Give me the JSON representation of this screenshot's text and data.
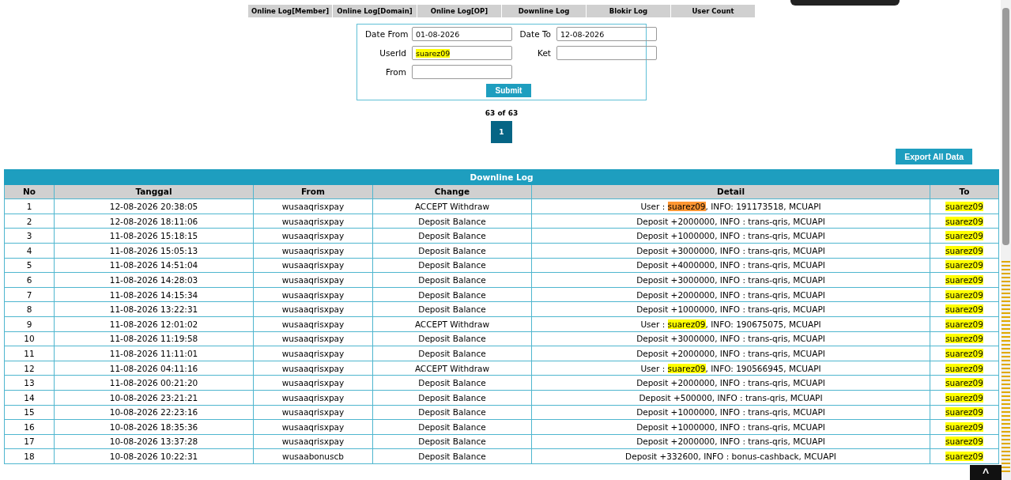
{
  "tabs": [
    {
      "label": "Online Log[Member]",
      "selected": false
    },
    {
      "label": "Online Log[Domain]",
      "selected": false
    },
    {
      "label": "Online Log[OP]",
      "selected": false
    },
    {
      "label": "Downline Log",
      "selected": false
    },
    {
      "label": "Blokir Log",
      "selected": false
    },
    {
      "label": "User Count",
      "selected": false
    }
  ],
  "filter": {
    "fields": [
      {
        "label": "Date From",
        "value": "01-08-2026",
        "highlighted": false
      },
      {
        "label": "Date To",
        "value": "12-08-2026",
        "highlighted": false
      },
      {
        "label": "UserId",
        "value": "suarez09",
        "highlighted": true
      },
      {
        "label": "Ket"
      },
      {
        "label": "From"
      }
    ],
    "submit": "Submit"
  },
  "pagination": {
    "summary": "63 of 63",
    "pages": [
      {
        "label": "1",
        "selected": true
      }
    ]
  },
  "export_button": "Export All Data",
  "table": {
    "title": "Downline Log",
    "columns": [
      "No",
      "Tanggal",
      "From",
      "Change",
      "Detail",
      "To"
    ],
    "rows": [
      {
        "no": "1",
        "tanggal": "12-08-2026 20:38:05",
        "from": "wusaaqrisxpay",
        "change": "ACCEPT Withdraw",
        "detail": [
          {
            "text": "User : ",
            "highlighted": false,
            "current": false
          },
          {
            "text": "suarez09",
            "highlighted": true,
            "current": true
          },
          {
            "text": ", INFO: 191173518, MCUAPI",
            "highlighted": false,
            "current": false
          }
        ],
        "to": "suarez09",
        "to_highlighted": true
      },
      {
        "no": "2",
        "tanggal": "12-08-2026 18:11:06",
        "from": "wusaaqrisxpay",
        "change": "Deposit Balance",
        "detail": [
          {
            "text": "Deposit +2000000, INFO : trans-qris, MCUAPI",
            "highlighted": false,
            "current": false
          }
        ],
        "to": "suarez09",
        "to_highlighted": true
      },
      {
        "no": "3",
        "tanggal": "11-08-2026 15:18:15",
        "from": "wusaaqrisxpay",
        "change": "Deposit Balance",
        "detail": [
          {
            "text": "Deposit +1000000, INFO : trans-qris, MCUAPI",
            "highlighted": false,
            "current": false
          }
        ],
        "to": "suarez09",
        "to_highlighted": true
      },
      {
        "no": "4",
        "tanggal": "11-08-2026 15:05:13",
        "from": "wusaaqrisxpay",
        "change": "Deposit Balance",
        "detail": [
          {
            "text": "Deposit +3000000, INFO : trans-qris, MCUAPI",
            "highlighted": false,
            "current": false
          }
        ],
        "to": "suarez09",
        "to_highlighted": true
      },
      {
        "no": "5",
        "tanggal": "11-08-2026 14:51:04",
        "from": "wusaaqrisxpay",
        "change": "Deposit Balance",
        "detail": [
          {
            "text": "Deposit +4000000, INFO : trans-qris, MCUAPI",
            "highlighted": false,
            "current": false
          }
        ],
        "to": "suarez09",
        "to_highlighted": true
      },
      {
        "no": "6",
        "tanggal": "11-08-2026 14:28:03",
        "from": "wusaaqrisxpay",
        "change": "Deposit Balance",
        "detail": [
          {
            "text": "Deposit +3000000, INFO : trans-qris, MCUAPI",
            "highlighted": false,
            "current": false
          }
        ],
        "to": "suarez09",
        "to_highlighted": true
      },
      {
        "no": "7",
        "tanggal": "11-08-2026 14:15:34",
        "from": "wusaaqrisxpay",
        "change": "Deposit Balance",
        "detail": [
          {
            "text": "Deposit +2000000, INFO : trans-qris, MCUAPI",
            "highlighted": false,
            "current": false
          }
        ],
        "to": "suarez09",
        "to_highlighted": true
      },
      {
        "no": "8",
        "tanggal": "11-08-2026 13:22:31",
        "from": "wusaaqrisxpay",
        "change": "Deposit Balance",
        "detail": [
          {
            "text": "Deposit +1000000, INFO : trans-qris, MCUAPI",
            "highlighted": false,
            "current": false
          }
        ],
        "to": "suarez09",
        "to_highlighted": true
      },
      {
        "no": "9",
        "tanggal": "11-08-2026 12:01:02",
        "from": "wusaaqrisxpay",
        "change": "ACCEPT Withdraw",
        "detail": [
          {
            "text": "User : ",
            "highlighted": false,
            "current": false
          },
          {
            "text": "suarez09",
            "highlighted": true,
            "current": false
          },
          {
            "text": ", INFO: 190675075, MCUAPI",
            "highlighted": false,
            "current": false
          }
        ],
        "to": "suarez09",
        "to_highlighted": true
      },
      {
        "no": "10",
        "tanggal": "11-08-2026 11:19:58",
        "from": "wusaaqrisxpay",
        "change": "Deposit Balance",
        "detail": [
          {
            "text": "Deposit +3000000, INFO : trans-qris, MCUAPI",
            "highlighted": false,
            "current": false
          }
        ],
        "to": "suarez09",
        "to_highlighted": true
      },
      {
        "no": "11",
        "tanggal": "11-08-2026 11:11:01",
        "from": "wusaaqrisxpay",
        "change": "Deposit Balance",
        "detail": [
          {
            "text": "Deposit +2000000, INFO : trans-qris, MCUAPI",
            "highlighted": false,
            "current": false
          }
        ],
        "to": "suarez09",
        "to_highlighted": true
      },
      {
        "no": "12",
        "tanggal": "11-08-2026 04:11:16",
        "from": "wusaaqrisxpay",
        "change": "ACCEPT Withdraw",
        "detail": [
          {
            "text": "User : ",
            "highlighted": false,
            "current": false
          },
          {
            "text": "suarez09",
            "highlighted": true,
            "current": false
          },
          {
            "text": ", INFO: 190566945, MCUAPI",
            "highlighted": false,
            "current": false
          }
        ],
        "to": "suarez09",
        "to_highlighted": true
      },
      {
        "no": "13",
        "tanggal": "11-08-2026 00:21:20",
        "from": "wusaaqrisxpay",
        "change": "Deposit Balance",
        "detail": [
          {
            "text": "Deposit +2000000, INFO : trans-qris, MCUAPI",
            "highlighted": false,
            "current": false
          }
        ],
        "to": "suarez09",
        "to_highlighted": true
      },
      {
        "no": "14",
        "tanggal": "10-08-2026 23:21:21",
        "from": "wusaaqrisxpay",
        "change": "Deposit Balance",
        "detail": [
          {
            "text": "Deposit +500000, INFO : trans-qris, MCUAPI",
            "highlighted": false,
            "current": false
          }
        ],
        "to": "suarez09",
        "to_highlighted": true
      },
      {
        "no": "15",
        "tanggal": "10-08-2026 22:23:16",
        "from": "wusaaqrisxpay",
        "change": "Deposit Balance",
        "detail": [
          {
            "text": "Deposit +1000000, INFO : trans-qris, MCUAPI",
            "highlighted": false,
            "current": false
          }
        ],
        "to": "suarez09",
        "to_highlighted": true
      },
      {
        "no": "16",
        "tanggal": "10-08-2026 18:35:36",
        "from": "wusaaqrisxpay",
        "change": "Deposit Balance",
        "detail": [
          {
            "text": "Deposit +1000000, INFO : trans-qris, MCUAPI",
            "highlighted": false,
            "current": false
          }
        ],
        "to": "suarez09",
        "to_highlighted": true
      },
      {
        "no": "17",
        "tanggal": "10-08-2026 13:37:28",
        "from": "wusaaqrisxpay",
        "change": "Deposit Balance",
        "detail": [
          {
            "text": "Deposit +2000000, INFO : trans-qris, MCUAPI",
            "highlighted": false,
            "current": false
          }
        ],
        "to": "suarez09",
        "to_highlighted": true
      },
      {
        "no": "18",
        "tanggal": "10-08-2026 10:22:31",
        "from": "wusaabonuscb",
        "change": "Deposit Balance",
        "detail": [
          {
            "text": "Deposit +332600, INFO : bonus-cashback, MCUAPI",
            "highlighted": false,
            "current": false
          }
        ],
        "to": "suarez09",
        "to_highlighted": true
      }
    ]
  },
  "back_to_top": "^"
}
